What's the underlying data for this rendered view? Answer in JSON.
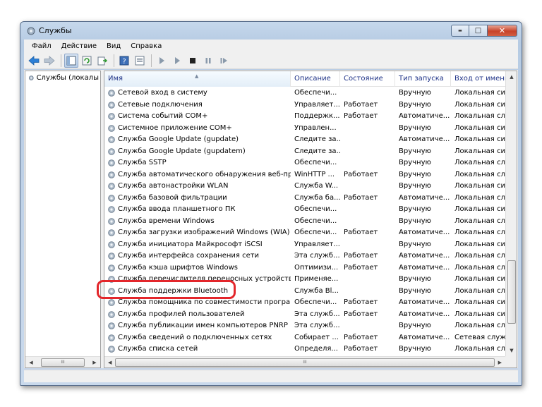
{
  "window": {
    "title": "Службы",
    "controls": {
      "minimize": "▬",
      "maximize": "□",
      "close": "✕"
    }
  },
  "menu": [
    "Файл",
    "Действие",
    "Вид",
    "Справка"
  ],
  "tree": {
    "item_label": "Службы (локалы"
  },
  "table": {
    "headers": [
      "Имя",
      "Описание",
      "Состояние",
      "Тип запуска",
      "Вход от имени"
    ],
    "sorted_column": "Имя",
    "rows": [
      [
        "Сетевой вход в систему",
        "Обеспечи...",
        "",
        "Вручную",
        "Локальная сис..."
      ],
      [
        "Сетевые подключения",
        "Управляет...",
        "Работает",
        "Вручную",
        "Локальная сис..."
      ],
      [
        "Система событий COM+",
        "Поддержк...",
        "Работает",
        "Автоматиче...",
        "Локальная слу..."
      ],
      [
        "Системное приложение COM+",
        "Управлен...",
        "",
        "Вручную",
        "Локальная сис..."
      ],
      [
        "Служба Google Update (gupdate)",
        "Следите за...",
        "",
        "Автоматиче...",
        "Локальная сис..."
      ],
      [
        "Служба Google Update (gupdatem)",
        "Следите за...",
        "",
        "Вручную",
        "Локальная сис..."
      ],
      [
        "Служба SSTP",
        "Обеспечи...",
        "",
        "Вручную",
        "Локальная слу..."
      ],
      [
        "Служба автоматического обнаружения веб-про...",
        "WinHTTP ...",
        "Работает",
        "Вручную",
        "Локальная слу..."
      ],
      [
        "Служба автонастройки WLAN",
        "Служба W...",
        "",
        "Вручную",
        "Локальная сис..."
      ],
      [
        "Служба базовой фильтрации",
        "Служба ба...",
        "Работает",
        "Автоматиче...",
        "Локальная слу..."
      ],
      [
        "Служба ввода планшетного ПК",
        "Обеспечи...",
        "",
        "Вручную",
        "Локальная сис..."
      ],
      [
        "Служба времени Windows",
        "Обеспечи...",
        "",
        "Вручную",
        "Локальная слу..."
      ],
      [
        "Служба загрузки изображений Windows (WIA)",
        "Обеспечи...",
        "Работает",
        "Автоматиче...",
        "Локальная слу..."
      ],
      [
        "Служба инициатора Майкрософт iSCSI",
        "Управляет...",
        "",
        "Вручную",
        "Локальная сис..."
      ],
      [
        "Служба интерфейса сохранения сети",
        "Эта служб...",
        "Работает",
        "Автоматиче...",
        "Локальная слу..."
      ],
      [
        "Служба кэша шрифтов Windows",
        "Оптимизи...",
        "Работает",
        "Автоматиче...",
        "Локальная слу..."
      ],
      [
        "Служба перечислителя переносных устройств",
        "Применяе...",
        "",
        "Вручную",
        "Локальная сис..."
      ],
      [
        "Служба поддержки Bluetooth",
        "Служба Bl...",
        "",
        "Вручную",
        "Локальная слу..."
      ],
      [
        "Служба помощника по совместимости программ",
        "Обеспечи...",
        "Работает",
        "Автоматиче...",
        "Локальная сис..."
      ],
      [
        "Служба профилей пользователей",
        "Эта служб...",
        "Работает",
        "Автоматиче...",
        "Локальная сис..."
      ],
      [
        "Служба публикации имен компьютеров PNRP",
        "Эта служб...",
        "",
        "Вручную",
        "Локальная слу..."
      ],
      [
        "Служба сведений о подключенных сетях",
        "Собирает ...",
        "Работает",
        "Автоматиче...",
        "Сетевая служба"
      ],
      [
        "Служба списка сетей",
        "Определя...",
        "Работает",
        "Вручную",
        "Локальная слу..."
      ]
    ],
    "highlighted_row": "Служба поддержки Bluetooth"
  },
  "scrollbars": {
    "thumb_grip": "III"
  },
  "colors": {
    "highlight": "#e3262b",
    "header_text": "#1e3287",
    "title_bar": "#c6d8ec"
  },
  "icons": [
    "services-app-icon",
    "back-icon",
    "forward-icon",
    "console-tree-icon",
    "refresh-icon",
    "export-list-icon",
    "help-icon",
    "properties-icon",
    "start-icon",
    "start-alt-icon",
    "stop-icon",
    "pause-icon",
    "restart-icon",
    "gear-icon"
  ]
}
